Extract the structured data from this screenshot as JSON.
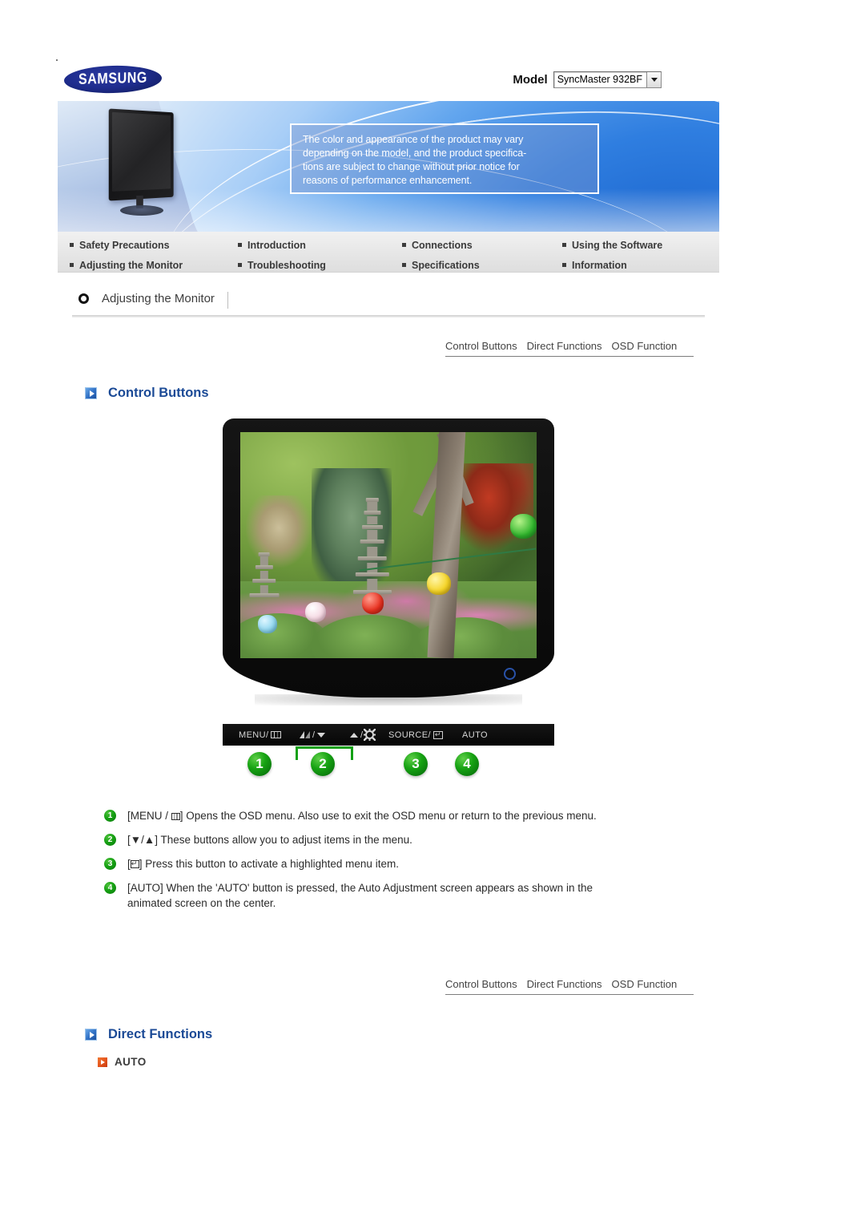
{
  "brand": {
    "logo_text": "SAMSUNG"
  },
  "model": {
    "label": "Model",
    "selected": "SyncMaster 932BF",
    "dropdown_icon": "chevron-down-icon"
  },
  "banner": {
    "note_line1": "The color and appearance of the product may vary",
    "note_line2": "depending on the model, and the product specifica-",
    "note_line3": "tions are subject to change without prior notice for",
    "note_line4": "reasons of performance enhancement."
  },
  "nav": {
    "items": [
      {
        "label": "Safety Precautions"
      },
      {
        "label": "Introduction"
      },
      {
        "label": "Connections"
      },
      {
        "label": "Using the Software"
      },
      {
        "label": "Adjusting the Monitor"
      },
      {
        "label": "Troubleshooting"
      },
      {
        "label": "Specifications"
      },
      {
        "label": "Information"
      }
    ]
  },
  "section": {
    "icon": "ring-icon",
    "title": "Adjusting the Monitor"
  },
  "tabs_top": [
    {
      "label": "Control Buttons"
    },
    {
      "label": "Direct Functions"
    },
    {
      "label": "OSD Function"
    }
  ],
  "tabs_bottom": [
    {
      "label": "Control Buttons"
    },
    {
      "label": "Direct Functions"
    },
    {
      "label": "OSD Function"
    }
  ],
  "headings": {
    "control_buttons": "Control Buttons",
    "direct_functions": "Direct Functions"
  },
  "control_bar": {
    "buttons": [
      {
        "label": "MENU/",
        "icon": "osd-menu-icon"
      },
      {
        "label": "/",
        "icon_left": "brightness-icon",
        "icon_right": "arrow-down-icon"
      },
      {
        "label": "/",
        "icon_left": "arrow-up-icon",
        "icon_right": "magicbright-gear-icon"
      },
      {
        "label": "SOURCE/",
        "icon": "enter-icon"
      },
      {
        "label": "AUTO",
        "icon": ""
      }
    ],
    "badges": [
      "1",
      "2",
      "3",
      "4"
    ]
  },
  "descriptions": [
    {
      "number": "1",
      "prefix": "[MENU / ",
      "glyph": "osd-menu-icon",
      "text": "] Opens the OSD menu. Also use to exit the OSD menu or return to the previous menu."
    },
    {
      "number": "2",
      "text": "[▼/▲] These buttons allow you to adjust items in the menu."
    },
    {
      "number": "3",
      "prefix": "[",
      "glyph": "enter-icon",
      "text": "] Press this button to activate a highlighted menu item."
    },
    {
      "number": "4",
      "text": "[AUTO] When the 'AUTO' button is pressed, the Auto Adjustment screen appears as shown in the animated screen on the center."
    }
  ],
  "direct_functions": {
    "items": [
      {
        "label": "AUTO"
      }
    ]
  },
  "colors": {
    "heading_blue": "#1b4a96",
    "badge_green": "#17a313",
    "orange": "#e4531c",
    "logo_blue": "#1f2d8e"
  }
}
